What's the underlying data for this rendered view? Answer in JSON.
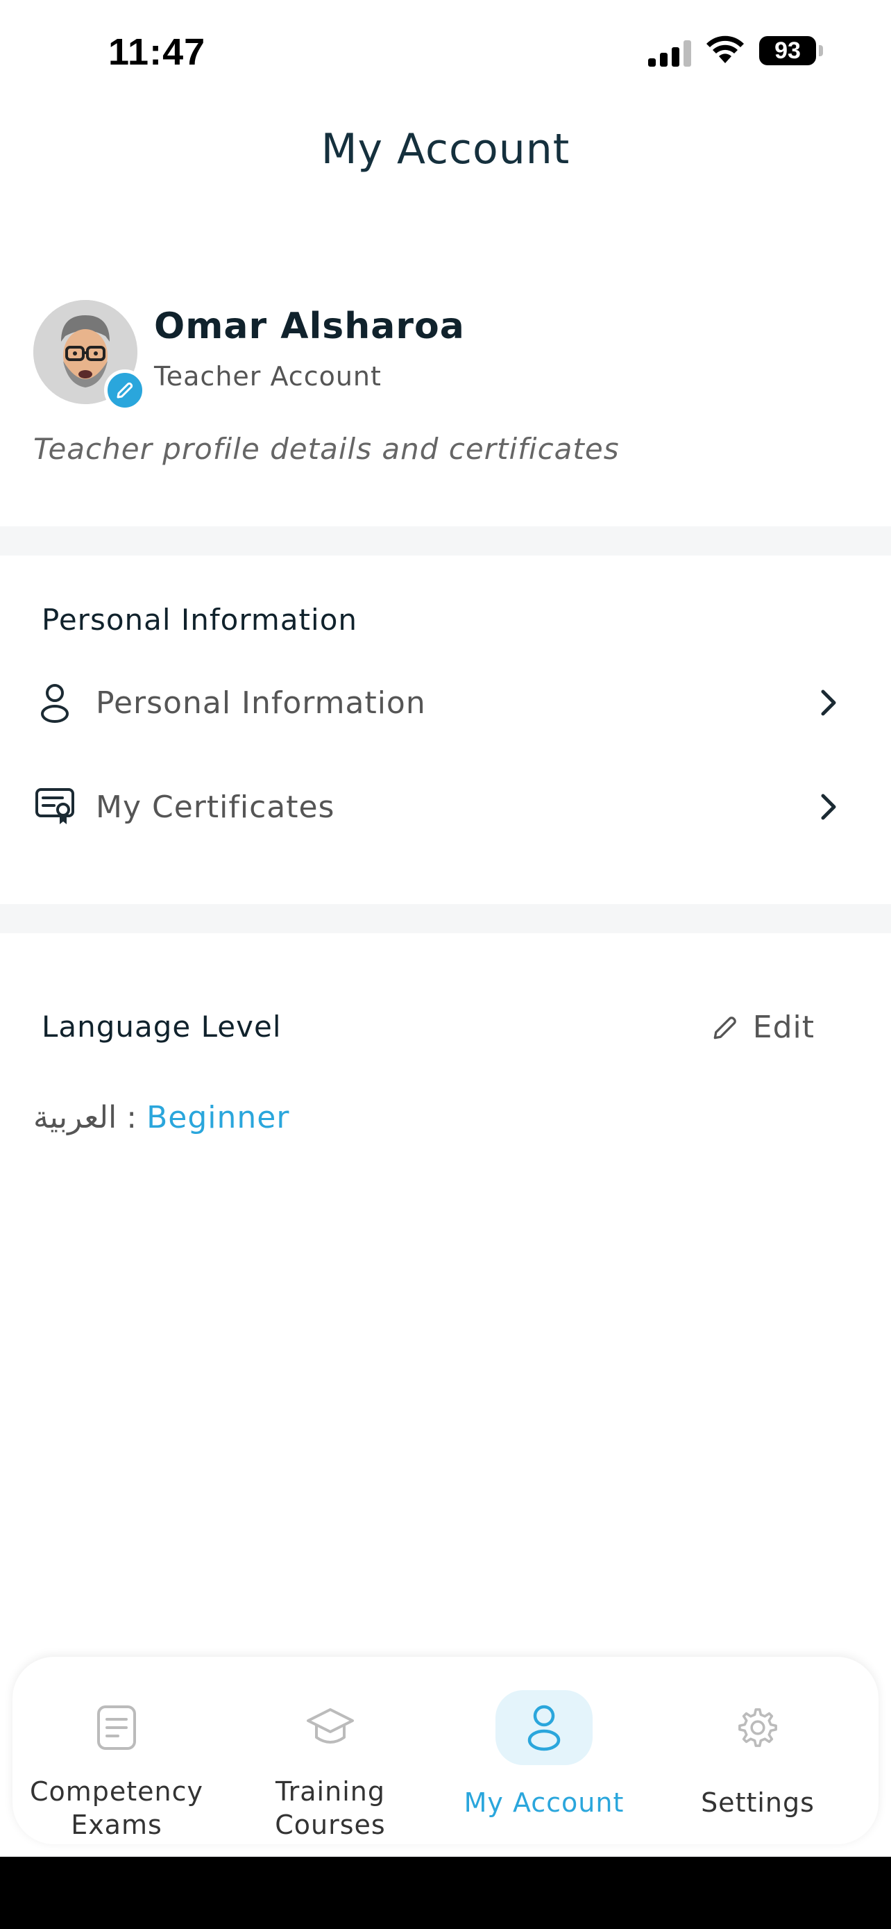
{
  "status_bar": {
    "time": "11:47",
    "battery": "93"
  },
  "header": {
    "title": "My Account"
  },
  "profile": {
    "name": "Omar Alsharoa",
    "role": "Teacher Account",
    "description": "Teacher profile details and certificates"
  },
  "personal_section": {
    "title": "Personal Information",
    "items": [
      {
        "label": "Personal Information",
        "icon": "user-icon"
      },
      {
        "label": "My Certificates",
        "icon": "certificate-icon"
      }
    ]
  },
  "language_section": {
    "title": "Language Level",
    "edit_label": "Edit",
    "language": "العربية",
    "separator": ":",
    "level": "Beginner"
  },
  "tab_bar": {
    "tabs": [
      {
        "label_line1": "Competency",
        "label_line2": "Exams",
        "icon": "document-icon"
      },
      {
        "label_line1": "Training",
        "label_line2": "Courses",
        "icon": "graduation-cap-icon"
      },
      {
        "label": "My Account",
        "icon": "user-icon",
        "active": true
      },
      {
        "label": "Settings",
        "icon": "gear-icon"
      }
    ]
  },
  "colors": {
    "accent": "#2aa6dc",
    "active_tab_bg": "#e4f4fb",
    "text_dark": "#10222c"
  }
}
